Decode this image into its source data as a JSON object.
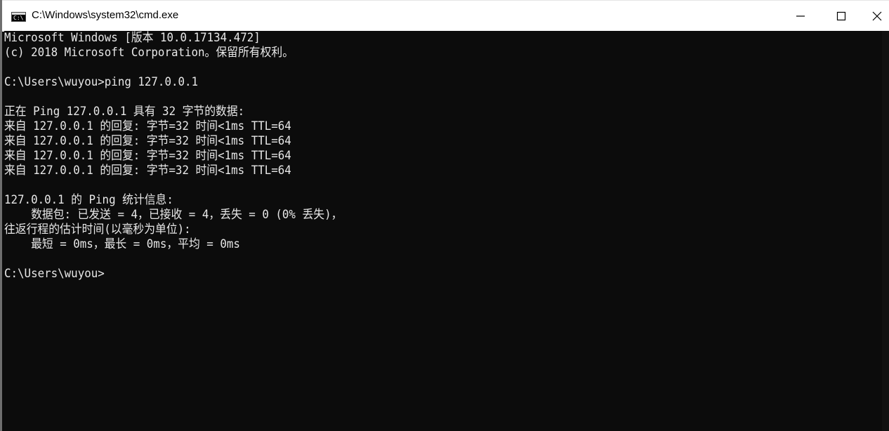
{
  "window": {
    "title": "C:\\Windows\\system32\\cmd.exe",
    "icon": "cmd-icon",
    "controls": {
      "minimize": "minimize-icon",
      "maximize": "maximize-icon",
      "close": "close-icon"
    }
  },
  "console": {
    "lines": [
      "Microsoft Windows [版本 10.0.17134.472]",
      "(c) 2018 Microsoft Corporation。保留所有权利。",
      "",
      "C:\\Users\\wuyou>ping 127.0.0.1",
      "",
      "正在 Ping 127.0.0.1 具有 32 字节的数据:",
      "来自 127.0.0.1 的回复: 字节=32 时间<1ms TTL=64",
      "来自 127.0.0.1 的回复: 字节=32 时间<1ms TTL=64",
      "来自 127.0.0.1 的回复: 字节=32 时间<1ms TTL=64",
      "来自 127.0.0.1 的回复: 字节=32 时间<1ms TTL=64",
      "",
      "127.0.0.1 的 Ping 统计信息:",
      "    数据包: 已发送 = 4，已接收 = 4，丢失 = 0 (0% 丢失)，",
      "往返行程的估计时间(以毫秒为单位):",
      "    最短 = 0ms，最长 = 0ms，平均 = 0ms",
      "",
      "C:\\Users\\wuyou>"
    ]
  }
}
